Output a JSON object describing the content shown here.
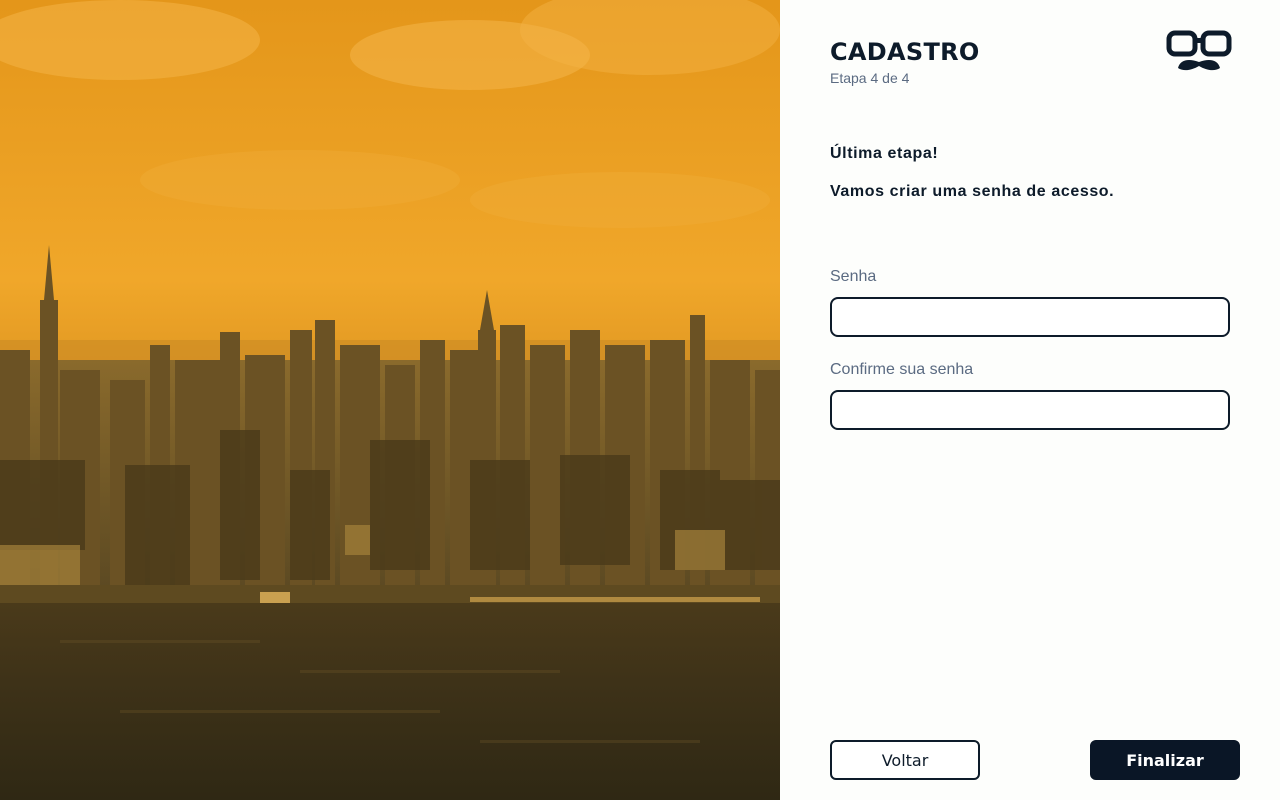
{
  "header": {
    "title": "CADASTRO",
    "step": "Etapa 4 de 4",
    "logo_icon": "glasses-mustache-icon"
  },
  "intro": {
    "title": "Última etapa!",
    "text": "Vamos criar uma senha de acesso."
  },
  "form": {
    "password_label": "Senha",
    "password_value": "",
    "confirm_label": "Confirme sua senha",
    "confirm_value": ""
  },
  "actions": {
    "back_label": "Voltar",
    "finish_label": "Finalizar"
  },
  "colors": {
    "accent": "#e59a1c",
    "dark": "#0d1b2a",
    "muted": "#5b6b82",
    "background": "#fdfefc"
  },
  "image": {
    "icon": "city-skyline-photo"
  }
}
